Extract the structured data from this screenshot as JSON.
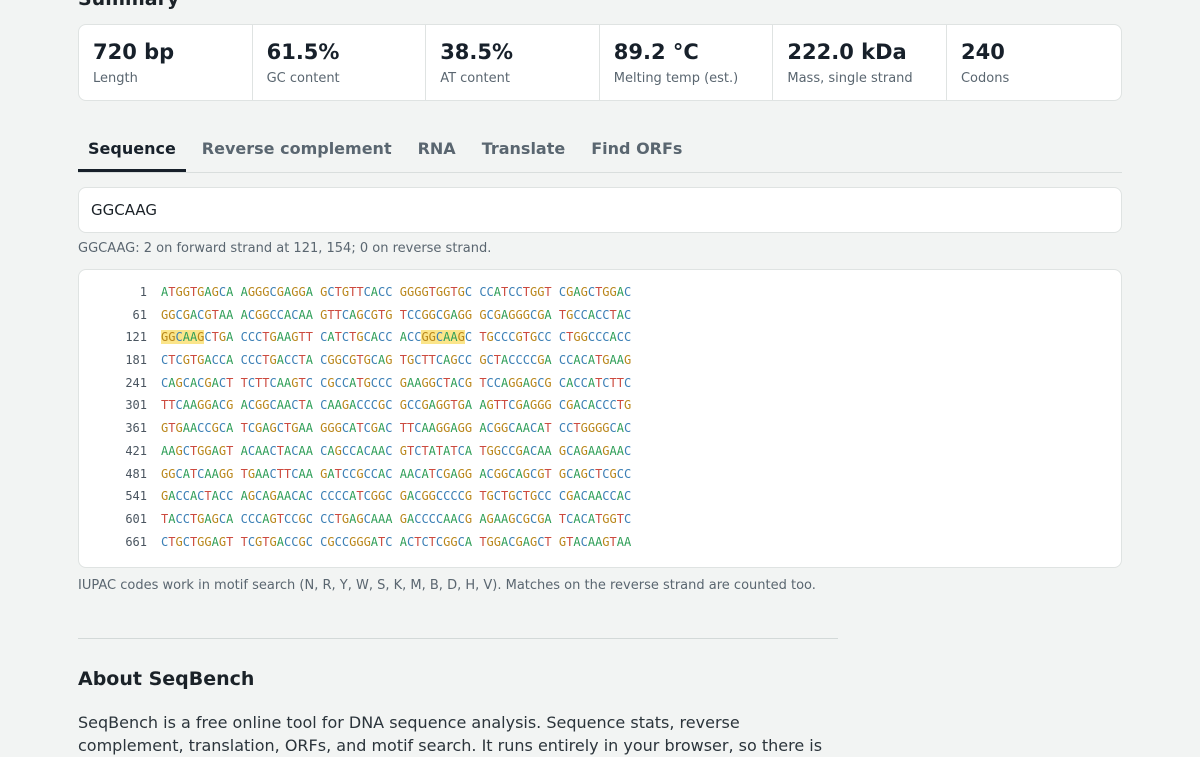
{
  "summary": {
    "title": "Summary",
    "stats": [
      {
        "value": "720 bp",
        "label": "Length"
      },
      {
        "value": "61.5%",
        "label": "GC content"
      },
      {
        "value": "38.5%",
        "label": "AT content"
      },
      {
        "value": "89.2 °C",
        "label": "Melting temp (est.)"
      },
      {
        "value": "222.0 kDa",
        "label": "Mass, single strand"
      },
      {
        "value": "240",
        "label": "Codons"
      }
    ]
  },
  "tabs": [
    {
      "label": "Sequence",
      "active": true
    },
    {
      "label": "Reverse complement",
      "active": false
    },
    {
      "label": "RNA",
      "active": false
    },
    {
      "label": "Translate",
      "active": false
    },
    {
      "label": "Find ORFs",
      "active": false
    }
  ],
  "search": {
    "value": "GGCAAG",
    "result": "GGCAAG: 2 on forward strand at 121, 154; 0 on reverse strand."
  },
  "sequence": {
    "motif": "GGCAAG",
    "highlight_positions": [
      121,
      154
    ],
    "rows": [
      {
        "pos": "1",
        "groups": [
          "ATGGTGAGCA",
          "AGGGCGAGGA",
          "GCTGTTCACC",
          "GGGGTGGTGC",
          "CCATCCTGGT",
          "CGAGCTGGAC"
        ]
      },
      {
        "pos": "61",
        "groups": [
          "GGCGACGTAA",
          "ACGGCCACAA",
          "GTTCAGCGTG",
          "TCCGGCGAGG",
          "GCGAGGGCGA",
          "TGCCACCTAC"
        ]
      },
      {
        "pos": "121",
        "groups": [
          "GGCAAGCTGA",
          "CCCTGAAGTT",
          "CATCTGCACC",
          "ACCGGCAAGC",
          "TGCCCGTGCC",
          "CTGGCCCACC"
        ]
      },
      {
        "pos": "181",
        "groups": [
          "CTCGTGACCA",
          "CCCTGACCTA",
          "CGGCGTGCAG",
          "TGCTTCAGCC",
          "GCTACCCCGA",
          "CCACATGAAG"
        ]
      },
      {
        "pos": "241",
        "groups": [
          "CAGCACGACT",
          "TCTTCAAGTC",
          "CGCCATGCCC",
          "GAAGGCTACG",
          "TCCAGGAGCG",
          "CACCATCTTC"
        ]
      },
      {
        "pos": "301",
        "groups": [
          "TTCAAGGACG",
          "ACGGCAACTA",
          "CAAGACCCGC",
          "GCCGAGGTGA",
          "AGTTCGAGGG",
          "CGACACCCTG"
        ]
      },
      {
        "pos": "361",
        "groups": [
          "GTGAACCGCA",
          "TCGAGCTGAA",
          "GGGCATCGAC",
          "TTCAAGGAGG",
          "ACGGCAACAT",
          "CCTGGGGCAC"
        ]
      },
      {
        "pos": "421",
        "groups": [
          "AAGCTGGAGT",
          "ACAACTACAA",
          "CAGCCACAAC",
          "GTCTATATCA",
          "TGGCCGACAA",
          "GCAGAAGAAC"
        ]
      },
      {
        "pos": "481",
        "groups": [
          "GGCATCAAGG",
          "TGAACTTCAA",
          "GATCCGCCAC",
          "AACATCGAGG",
          "ACGGCAGCGT",
          "GCAGCTCGCC"
        ]
      },
      {
        "pos": "541",
        "groups": [
          "GACCACTACC",
          "AGCAGAACAC",
          "CCCCATCGGC",
          "GACGGCCCCG",
          "TGCTGCTGCC",
          "CGACAACCAC"
        ]
      },
      {
        "pos": "601",
        "groups": [
          "TACCTGAGCA",
          "CCCAGTCCGC",
          "CCTGAGCAAA",
          "GACCCCAACG",
          "AGAAGCGCGA",
          "TCACATGGTC"
        ]
      },
      {
        "pos": "661",
        "groups": [
          "CTGCTGGAGT",
          "TCGTGACCGC",
          "CGCCGGGATC",
          "ACTCTCGGCA",
          "TGGACGAGCT",
          "GTACAAGTAA"
        ]
      }
    ]
  },
  "hint": "IUPAC codes work in motif search (N, R, Y, W, S, K, M, B, D, H, V). Matches on the reverse strand are counted too.",
  "about": {
    "title": "About SeqBench",
    "text": "SeqBench is a free online tool for DNA sequence analysis. Sequence stats, reverse complement, translation, ORFs, and motif search. It runs entirely in your browser, so there is"
  },
  "colors": {
    "A": "#2e9e57",
    "T": "#cc4a3f",
    "G": "#b9861a",
    "C": "#3b7fb5",
    "highlight": "#fbe58a"
  }
}
